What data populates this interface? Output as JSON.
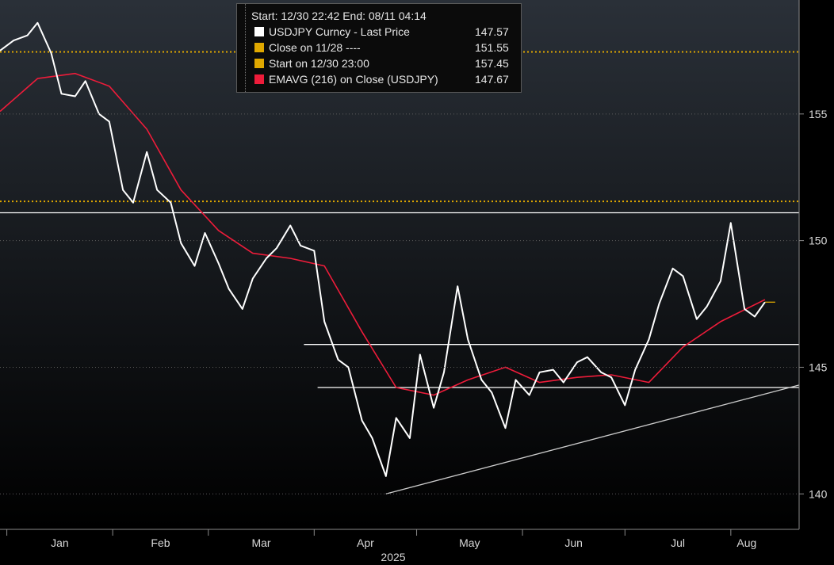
{
  "legend": {
    "header": "Start: 12/30 22:42  End: 08/11 04:14",
    "rows": [
      {
        "label": "USDJPY Curncy - Last Price",
        "value": "147.57",
        "color": "#ffffff"
      },
      {
        "label": "Close on 11/28 ----",
        "value": "151.55",
        "color": "#e0a800"
      },
      {
        "label": "Start on 12/30 23:00",
        "value": "157.45",
        "color": "#e0a800"
      },
      {
        "label": "EMAVG (216)  on Close (USDJPY)",
        "value": "147.67",
        "color": "#ee1c3a"
      }
    ]
  },
  "chart_data": {
    "type": "line",
    "title": "",
    "xlabel": "2025",
    "ylabel": "",
    "ylim": [
      138.6,
      159.5
    ],
    "yticks": [
      140,
      145,
      150,
      155
    ],
    "xticks": [
      "Jan",
      "Feb",
      "Mar",
      "Apr",
      "May",
      "Jun",
      "Jul",
      "Aug"
    ],
    "xtick_dates": [
      "2025-01-01",
      "2025-02-01",
      "2025-03-01",
      "2025-04-01",
      "2025-05-01",
      "2025-06-01",
      "2025-07-01",
      "2025-08-01"
    ],
    "xlim": [
      "2024-12-30",
      "2025-08-21"
    ],
    "series": [
      {
        "name": "USDJPY Curncy - Last Price",
        "color": "#ffffff",
        "x": [
          "2024-12-30",
          "2025-01-03",
          "2025-01-07",
          "2025-01-10",
          "2025-01-14",
          "2025-01-17",
          "2025-01-21",
          "2025-01-24",
          "2025-01-28",
          "2025-01-31",
          "2025-02-04",
          "2025-02-07",
          "2025-02-11",
          "2025-02-14",
          "2025-02-18",
          "2025-02-21",
          "2025-02-25",
          "2025-02-28",
          "2025-03-04",
          "2025-03-07",
          "2025-03-11",
          "2025-03-14",
          "2025-03-18",
          "2025-03-21",
          "2025-03-25",
          "2025-03-28",
          "2025-04-01",
          "2025-04-04",
          "2025-04-08",
          "2025-04-11",
          "2025-04-15",
          "2025-04-18",
          "2025-04-22",
          "2025-04-25",
          "2025-04-29",
          "2025-05-02",
          "2025-05-06",
          "2025-05-09",
          "2025-05-13",
          "2025-05-16",
          "2025-05-20",
          "2025-05-23",
          "2025-05-27",
          "2025-05-30",
          "2025-06-03",
          "2025-06-06",
          "2025-06-10",
          "2025-06-13",
          "2025-06-17",
          "2025-06-20",
          "2025-06-24",
          "2025-06-27",
          "2025-07-01",
          "2025-07-04",
          "2025-07-08",
          "2025-07-11",
          "2025-07-15",
          "2025-07-18",
          "2025-07-22",
          "2025-07-25",
          "2025-07-29",
          "2025-08-01",
          "2025-08-05",
          "2025-08-08",
          "2025-08-11"
        ],
        "y": [
          157.5,
          157.9,
          158.1,
          158.6,
          157.4,
          155.8,
          155.7,
          156.3,
          155.0,
          154.7,
          152.0,
          151.5,
          153.5,
          152.0,
          151.5,
          149.9,
          149.0,
          150.3,
          149.1,
          148.1,
          147.3,
          148.5,
          149.3,
          149.7,
          150.6,
          149.8,
          149.6,
          146.8,
          145.3,
          145.0,
          142.9,
          142.2,
          140.7,
          143.0,
          142.2,
          145.5,
          143.4,
          144.8,
          148.2,
          146.1,
          144.5,
          144.0,
          142.6,
          144.5,
          143.9,
          144.8,
          144.9,
          144.4,
          145.2,
          145.4,
          144.8,
          144.6,
          143.5,
          144.9,
          146.1,
          147.5,
          148.9,
          148.6,
          146.9,
          147.4,
          148.4,
          150.7,
          147.3,
          147.0,
          147.57
        ]
      },
      {
        "name": "EMAVG (216)  on Close (USDJPY)",
        "color": "#ee1c3a",
        "x": [
          "2024-12-30",
          "2025-01-10",
          "2025-01-21",
          "2025-01-31",
          "2025-02-11",
          "2025-02-21",
          "2025-03-04",
          "2025-03-14",
          "2025-03-25",
          "2025-04-04",
          "2025-04-15",
          "2025-04-25",
          "2025-05-06",
          "2025-05-16",
          "2025-05-27",
          "2025-06-06",
          "2025-06-17",
          "2025-06-27",
          "2025-07-08",
          "2025-07-18",
          "2025-07-29",
          "2025-08-11"
        ],
        "y": [
          155.1,
          156.4,
          156.6,
          156.1,
          154.4,
          152.0,
          150.4,
          149.5,
          149.3,
          149.0,
          146.4,
          144.2,
          143.9,
          144.5,
          145.0,
          144.4,
          144.6,
          144.7,
          144.4,
          145.8,
          146.8,
          147.67
        ]
      }
    ],
    "reference_lines": [
      {
        "label": "Close on 11/28",
        "value": 151.55,
        "color": "#e0a800",
        "style": "dotted",
        "from": "2024-12-30",
        "to": "2025-08-21"
      },
      {
        "label": "Start on 12/30",
        "value": 157.45,
        "color": "#e0a800",
        "style": "dotted",
        "from": "2024-12-30",
        "to": "2025-08-21"
      },
      {
        "value": 151.1,
        "color": "#ffffff",
        "style": "solid",
        "from": "2024-12-30",
        "to": "2025-08-21"
      },
      {
        "value": 145.9,
        "color": "#ffffff",
        "style": "solid",
        "from": "2025-03-29",
        "to": "2025-08-21"
      },
      {
        "value": 144.2,
        "color": "#ffffff",
        "style": "solid",
        "from": "2025-04-02",
        "to": "2025-08-21"
      },
      {
        "value": 147.57,
        "color": "#e0a800",
        "style": "solid",
        "from": "2025-08-11",
        "to": "2025-08-14"
      }
    ],
    "trend_lines": [
      {
        "from": [
          "2025-04-22",
          140.0
        ],
        "to": [
          "2025-08-21",
          144.3
        ],
        "color": "#cccccc"
      }
    ],
    "grid": false,
    "legend_position": "top-center"
  }
}
